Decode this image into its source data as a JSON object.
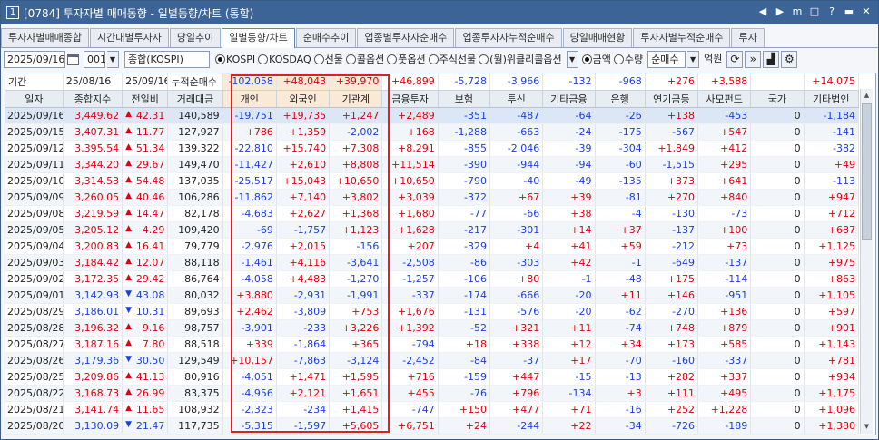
{
  "title": {
    "num": "1",
    "text": "[0784] 투자자별 매매동향 - 일별동향/차트 (통합)",
    "buttons": [
      "◀",
      "▶",
      "m",
      "□",
      "?",
      "▬",
      "✕"
    ]
  },
  "tabs": [
    "투자자별매매종합",
    "시간대별투자자",
    "당일추이",
    "일별동향/차트",
    "순매수추이",
    "업종별투자자순매수",
    "업종투자자누적순매수",
    "당일매매현황",
    "투자자별누적순매수",
    "투자"
  ],
  "active_tab": 3,
  "toolbar": {
    "date": "2025/09/16",
    "code": "001",
    "name": "종합(KOSPI)",
    "radios": [
      {
        "label": "KOSPI",
        "on": true
      },
      {
        "label": "KOSDAQ",
        "on": false
      },
      {
        "label": "선물",
        "on": false
      },
      {
        "label": "콜옵션",
        "on": false
      },
      {
        "label": "풋옵션",
        "on": false
      },
      {
        "label": "주식선물",
        "on": false
      },
      {
        "label": "(월)위클리콜옵션",
        "on": false
      }
    ],
    "radios2": [
      {
        "label": "금액",
        "on": true
      },
      {
        "label": "수량",
        "on": false
      }
    ],
    "mode": "순매수",
    "unit": "억원"
  },
  "period": {
    "label": "기간",
    "from": "25/08/16",
    "to": "25/09/16",
    "cum_label": "누적순매수"
  },
  "summary": [
    "-102,058",
    "+48,043",
    "+39,970",
    "+46,899",
    "-5,728",
    "-3,966",
    "-132",
    "-968",
    "+276",
    "+3,588",
    "",
    "+14,075"
  ],
  "headers": [
    "일자",
    "종합지수",
    "전일비",
    "거래대금",
    "개인",
    "외국인",
    "기관계",
    "금융투자",
    "보험",
    "투신",
    "기타금융",
    "은행",
    "연기금등",
    "사모펀드",
    "국가",
    "기타법인"
  ],
  "rows": [
    [
      "2025/09/16",
      "3,449.62",
      "up",
      "42.31",
      "140,589",
      "-19,751",
      "+19,735",
      "+1,247",
      "+2,489",
      "-351",
      "-487",
      "-64",
      "-26",
      "+138",
      "-453",
      "0",
      "-1,184"
    ],
    [
      "2025/09/15",
      "3,407.31",
      "up",
      "11.77",
      "127,927",
      "+786",
      "+1,359",
      "-2,002",
      "+168",
      "-1,288",
      "-663",
      "-24",
      "-175",
      "-567",
      "+547",
      "0",
      "-141"
    ],
    [
      "2025/09/12",
      "3,395.54",
      "up",
      "51.34",
      "139,322",
      "-22,810",
      "+15,740",
      "+7,308",
      "+8,291",
      "-855",
      "-2,046",
      "-39",
      "-304",
      "+1,849",
      "+412",
      "0",
      "-382"
    ],
    [
      "2025/09/11",
      "3,344.20",
      "up",
      "29.67",
      "149,470",
      "-11,427",
      "+2,610",
      "+8,808",
      "+11,514",
      "-390",
      "-944",
      "-94",
      "-60",
      "-1,515",
      "+295",
      "0",
      "+49"
    ],
    [
      "2025/09/10",
      "3,314.53",
      "up",
      "54.48",
      "137,035",
      "-25,517",
      "+15,043",
      "+10,650",
      "+10,650",
      "-790",
      "-40",
      "-49",
      "-135",
      "+373",
      "+641",
      "0",
      "-113"
    ],
    [
      "2025/09/09",
      "3,260.05",
      "up",
      "40.46",
      "106,286",
      "-11,862",
      "+7,140",
      "+3,802",
      "+3,039",
      "-372",
      "+67",
      "+39",
      "-81",
      "+270",
      "+840",
      "0",
      "+947"
    ],
    [
      "2025/09/08",
      "3,219.59",
      "up",
      "14.47",
      "82,178",
      "-4,683",
      "+2,627",
      "+1,368",
      "+1,680",
      "-77",
      "-66",
      "+38",
      "-4",
      "-130",
      "-73",
      "0",
      "+712"
    ],
    [
      "2025/09/05",
      "3,205.12",
      "up",
      "4.29",
      "109,420",
      "-69",
      "-1,757",
      "+1,123",
      "+1,628",
      "-217",
      "-301",
      "+14",
      "+37",
      "-137",
      "+100",
      "0",
      "+687"
    ],
    [
      "2025/09/04",
      "3,200.83",
      "up",
      "16.41",
      "79,779",
      "-2,976",
      "+2,015",
      "-156",
      "+207",
      "-329",
      "+4",
      "+41",
      "+59",
      "-212",
      "+73",
      "0",
      "+1,125"
    ],
    [
      "2025/09/03",
      "3,184.42",
      "up",
      "12.07",
      "88,118",
      "-1,461",
      "+4,116",
      "-3,641",
      "-2,508",
      "-86",
      "-303",
      "+42",
      "-1",
      "-649",
      "-137",
      "0",
      "+975"
    ],
    [
      "2025/09/02",
      "3,172.35",
      "up",
      "29.42",
      "86,764",
      "-4,058",
      "+4,483",
      "-1,270",
      "-1,257",
      "-106",
      "+80",
      "-1",
      "-48",
      "+175",
      "-114",
      "0",
      "+863"
    ],
    [
      "2025/09/01",
      "3,142.93",
      "dn",
      "43.08",
      "80,032",
      "+3,880",
      "-2,931",
      "-1,991",
      "-337",
      "-174",
      "-666",
      "-20",
      "+11",
      "+146",
      "-951",
      "0",
      "+1,105"
    ],
    [
      "2025/08/29",
      "3,186.01",
      "dn",
      "10.31",
      "89,693",
      "+2,462",
      "-3,809",
      "+753",
      "+1,676",
      "-131",
      "-576",
      "-20",
      "-62",
      "-270",
      "+136",
      "0",
      "+597"
    ],
    [
      "2025/08/28",
      "3,196.32",
      "up",
      "9.16",
      "98,757",
      "-3,901",
      "-233",
      "+3,226",
      "+1,392",
      "-52",
      "+321",
      "+11",
      "-74",
      "+748",
      "+879",
      "0",
      "+901"
    ],
    [
      "2025/08/27",
      "3,187.16",
      "up",
      "7.80",
      "88,518",
      "+339",
      "-1,864",
      "+365",
      "-794",
      "+18",
      "+338",
      "+12",
      "+34",
      "+173",
      "+585",
      "0",
      "+1,143"
    ],
    [
      "2025/08/26",
      "3,179.36",
      "dn",
      "30.50",
      "129,549",
      "+10,157",
      "-7,863",
      "-3,124",
      "-2,452",
      "-84",
      "-37",
      "+17",
      "-70",
      "-160",
      "-337",
      "0",
      "+781"
    ],
    [
      "2025/08/25",
      "3,209.86",
      "up",
      "41.13",
      "80,916",
      "-4,051",
      "+1,471",
      "+1,595",
      "+716",
      "-159",
      "+447",
      "-15",
      "-13",
      "+282",
      "+337",
      "0",
      "+934"
    ],
    [
      "2025/08/22",
      "3,168.73",
      "up",
      "26.99",
      "83,375",
      "-4,956",
      "+2,121",
      "+1,651",
      "+455",
      "-76",
      "+796",
      "-134",
      "+3",
      "+111",
      "+495",
      "0",
      "+1,175"
    ],
    [
      "2025/08/21",
      "3,141.74",
      "up",
      "11.65",
      "108,932",
      "-2,323",
      "-234",
      "+1,415",
      "-747",
      "+150",
      "+477",
      "+71",
      "-16",
      "+252",
      "+1,228",
      "0",
      "+1,096"
    ],
    [
      "2025/08/20",
      "3,130.09",
      "dn",
      "21.47",
      "117,735",
      "-5,315",
      "-1,597",
      "+5,605",
      "+6,751",
      "+24",
      "-244",
      "+22",
      "-34",
      "-726",
      "-189",
      "0",
      "+1,380"
    ]
  ]
}
